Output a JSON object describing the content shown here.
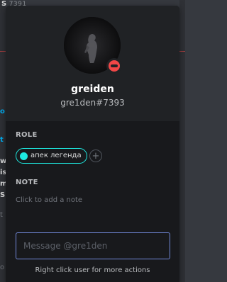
{
  "background": {
    "top_text": "S",
    "top_suffix": "7391",
    "left_glyphs": [
      {
        "text": "o",
        "style": "blue"
      },
      {
        "text": "t",
        "style": "blue"
      },
      {
        "text": "w",
        "style": "normal"
      },
      {
        "text": "is",
        "style": "normal"
      },
      {
        "text": "m",
        "style": "normal"
      },
      {
        "text": "S",
        "style": "normal"
      },
      {
        "text": "t",
        "style": "dim"
      },
      {
        "text": "o",
        "style": "dim"
      }
    ]
  },
  "profile": {
    "username": "greiden",
    "tag": "gre1den#7393",
    "status": "dnd",
    "status_color": "#f04747"
  },
  "roles": {
    "section_label": "ROLE",
    "items": [
      {
        "name": "апек легенда",
        "color": "#1de9e0"
      }
    ],
    "add_symbol": "+"
  },
  "note": {
    "section_label": "NOTE",
    "placeholder": "Click to add a note"
  },
  "message": {
    "placeholder": "Message @gre1den",
    "value": ""
  },
  "footer": {
    "hint": "Right click user for more actions"
  },
  "colors": {
    "popout_bg": "#18191c",
    "header_bg": "#202225",
    "input_border": "#7289da"
  }
}
